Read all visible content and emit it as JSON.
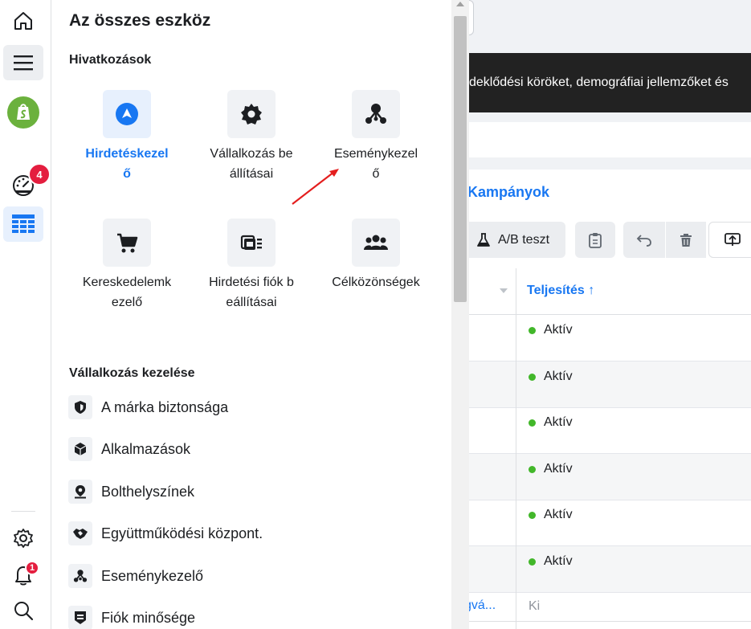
{
  "rail": {
    "notifications_badge": "4",
    "alerts_badge": "1",
    "icons": [
      "home-icon",
      "menu-icon",
      "account-logo",
      "dashboard-icon",
      "table-icon",
      "settings-icon",
      "bell-icon",
      "search-icon"
    ]
  },
  "panel": {
    "title": "Az összes eszköz",
    "shortcuts_title": "Hivatkozások",
    "tiles": [
      {
        "label": "Hirdetéskezelő",
        "icon": "ads-manager-icon",
        "active": true
      },
      {
        "label": "Vállalkozás beállításai",
        "icon": "gear-icon",
        "active": false
      },
      {
        "label": "Eseménykezelő",
        "icon": "events-manager-icon",
        "active": false
      },
      {
        "label": "Kereskedelemkezelő",
        "icon": "cart-icon",
        "active": false
      },
      {
        "label": "Hirdetési fiók beállításai",
        "icon": "ad-account-icon",
        "active": false
      },
      {
        "label": "Célközönségek",
        "icon": "audience-icon",
        "active": false
      }
    ],
    "business_title": "Vállalkozás kezelése",
    "business_items": [
      {
        "label": "A márka biztonsága",
        "icon": "shield-icon"
      },
      {
        "label": "Alkalmazások",
        "icon": "cube-icon"
      },
      {
        "label": "Bolthelyszínek",
        "icon": "location-pin-icon"
      },
      {
        "label": "Együttműködési központ.",
        "icon": "handshake-icon"
      },
      {
        "label": "Eseménykezelő",
        "icon": "events-manager-icon"
      },
      {
        "label": "Fiók minősége",
        "icon": "quality-icon"
      }
    ]
  },
  "background": {
    "banner_text": "deklődési köröket, demográfiai jellemzőket és",
    "campaigns_label": "Kampányok",
    "ab_test_label": "A/B teszt",
    "performance_header": "Teljesítés ↑",
    "rows": [
      "Aktív",
      "Aktív",
      "Aktív",
      "Aktív",
      "Aktív",
      "Aktív"
    ],
    "last_row_left": "gvá...",
    "last_row_right": "Ki",
    "colors": {
      "accent": "#1877f2",
      "active_dot": "#42b72a",
      "badge": "#e41e3f",
      "arrow": "#e41e1e"
    }
  }
}
